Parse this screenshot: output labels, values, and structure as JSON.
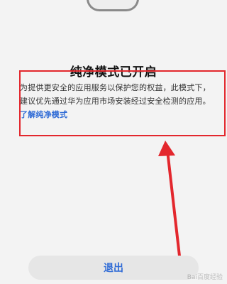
{
  "dialog": {
    "title": "纯净模式已开启",
    "description": "为提供更安全的应用服务以保护您的权益，此模式下，建议优先通过华为应用市场安装经过安全检测的应用。",
    "learn_more_link": "了解纯净模式"
  },
  "buttons": {
    "exit_label": "退出"
  },
  "annotation": {
    "highlight_color": "#e3272d"
  },
  "watermark": {
    "text": "Bai百度经验"
  },
  "colors": {
    "link": "#2f6bd6",
    "background": "#f3f3f3",
    "button_bg": "#e6e6e6"
  }
}
